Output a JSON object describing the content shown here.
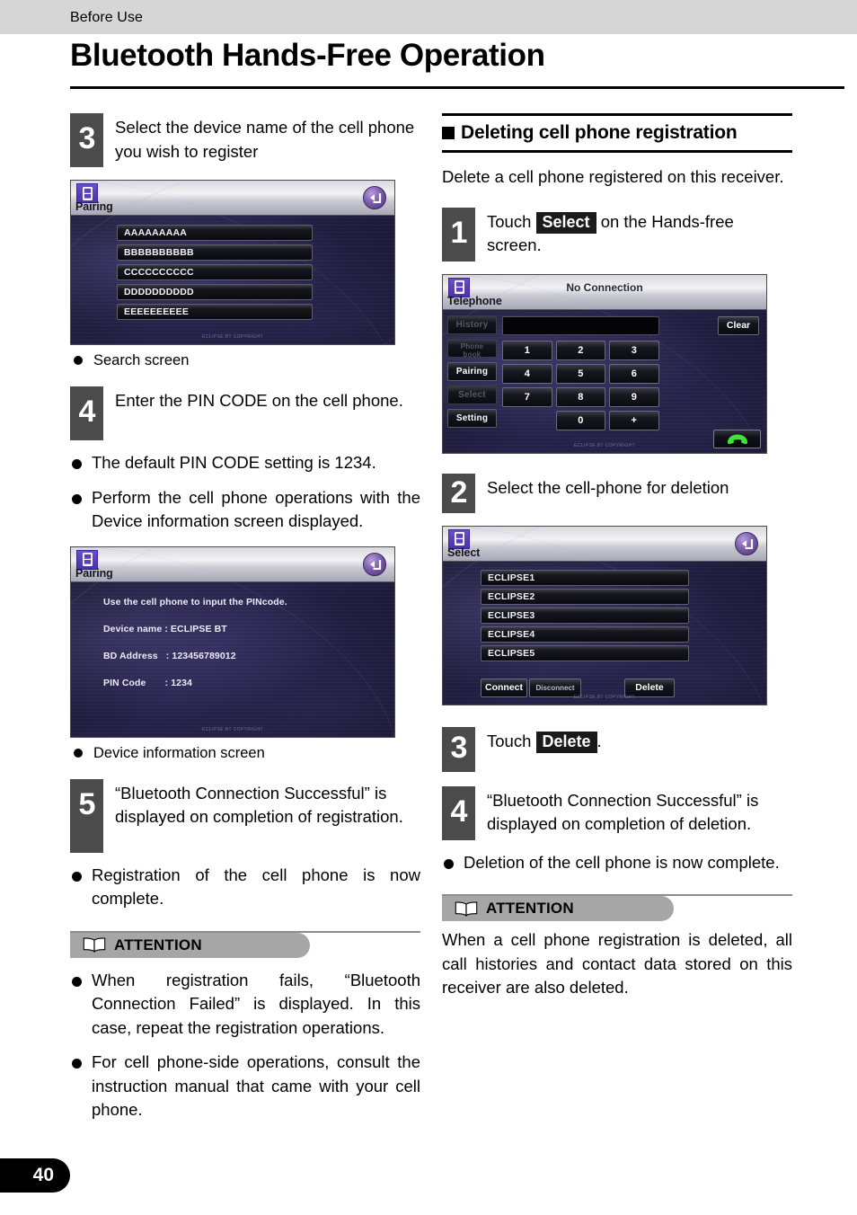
{
  "running_head": "Before Use",
  "page_title": "Bluetooth Hands-Free Operation",
  "page_number": "40",
  "left_column": {
    "step3": {
      "number": "3",
      "text": "Select the device name of the cell phone you wish to register"
    },
    "search_screen": {
      "app_name": "Pairing",
      "devices": [
        "AAAAAAAAA",
        "BBBBBBBBBB",
        "CCCCCCCCCC",
        "DDDDDDDDDD",
        "EEEEEEEEEE"
      ],
      "footer_text": "ECLIPSE BT   COPYRIGHT"
    },
    "search_caption": "Search screen",
    "step4": {
      "number": "4",
      "text": "Enter the PIN CODE on the cell phone."
    },
    "bullet_pin_default": "The default PIN CODE setting is 1234.",
    "bullet_perform": "Perform the cell phone operations with the Device information screen displayed.",
    "device_info_screen": {
      "app_name": "Pairing",
      "line1": "Use the cell phone to input the PINcode.",
      "line2": "Device name : ECLIPSE BT",
      "line3": "BD Address   : 123456789012",
      "line4": "PIN Code       : 1234",
      "footer_text": "ECLIPSE BT   COPYRIGHT"
    },
    "device_info_caption": "Device information screen",
    "step5": {
      "number": "5",
      "text": "“Bluetooth Connection Successful” is displayed on completion of registration."
    },
    "bullet_registration_complete": "Registration of the cell phone is now complete.",
    "attention": {
      "label": "ATTENTION",
      "bullets": [
        "When registration fails, “Bluetooth Connection Failed” is displayed. In this case, repeat the registration operations.",
        "For cell phone-side operations, consult the instruction manual that came with your cell phone."
      ]
    }
  },
  "right_column": {
    "section_heading": "Deleting cell phone registration",
    "section_intro": "Delete a cell phone registered on this receiver.",
    "step1": {
      "number": "1",
      "text_before": "Touch",
      "keycap": "Select",
      "text_after": "on the Hands-free screen."
    },
    "telephone_screen": {
      "app_name": "Telephone",
      "status": "No Connection",
      "side_buttons": [
        "History",
        "Phone\nbook",
        "Pairing",
        "Select",
        "Setting"
      ],
      "clear_label": "Clear",
      "keypad": [
        "1",
        "2",
        "3",
        "4",
        "5",
        "6",
        "7",
        "8",
        "9",
        "0",
        "+"
      ],
      "footer_text": "ECLIPSE BT   COPYRIGHT"
    },
    "step2": {
      "number": "2",
      "text": "Select the cell-phone for deletion"
    },
    "select_screen": {
      "app_name": "Select",
      "devices": [
        "ECLIPSE1",
        "ECLIPSE2",
        "ECLIPSE3",
        "ECLIPSE4",
        "ECLIPSE5"
      ],
      "actions": {
        "connect": "Connect",
        "disconnect": "Disconnect",
        "delete": "Delete"
      },
      "footer_text": "ECLIPSE BT   COPYRIGHT"
    },
    "step3": {
      "number": "3",
      "text_before": "Touch",
      "keycap": "Delete",
      "text_after": "."
    },
    "step4": {
      "number": "4",
      "text": "“Bluetooth Connection Successful” is displayed on completion of deletion."
    },
    "bullet_deletion_complete": "Deletion of the cell phone is now complete.",
    "attention": {
      "label": "ATTENTION",
      "paragraph": "When a cell phone registration is deleted, all call histories and contact data stored on this receiver are also deleted."
    }
  },
  "colors": {
    "header_band": "#d6d6d6",
    "step_box": "#4b4b4b",
    "attention_pill": "#a6a6a6",
    "keycap_bg": "#1a1a1a",
    "device_accent": "#5a3fc0"
  }
}
